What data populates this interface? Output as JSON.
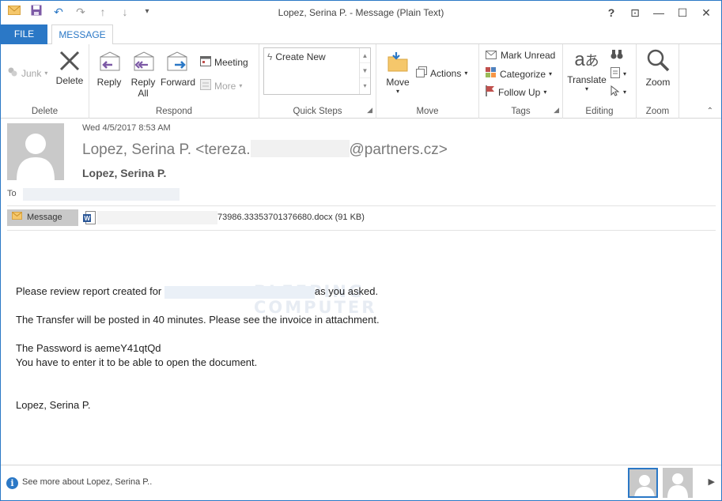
{
  "window": {
    "title": "Lopez, Serina P. - Message (Plain Text)"
  },
  "qat": {
    "undo": "↶",
    "redo": "↷",
    "up": "↑",
    "down": "↓",
    "customize": "▾"
  },
  "controls": {
    "help": "?",
    "restore_ribbon": "⊡",
    "minimize": "—",
    "maximize": "☐",
    "close": "✕"
  },
  "tabs": {
    "file": "FILE",
    "message": "MESSAGE"
  },
  "ribbon": {
    "delete_group": {
      "junk": "Junk",
      "delete": "Delete",
      "label": "Delete"
    },
    "respond_group": {
      "reply": "Reply",
      "reply_all_1": "Reply",
      "reply_all_2": "All",
      "forward": "Forward",
      "meeting": "Meeting",
      "more": "More",
      "label": "Respond"
    },
    "quicksteps_group": {
      "create_new": "Create New",
      "label": "Quick Steps"
    },
    "move_group": {
      "move": "Move",
      "actions": "Actions",
      "label": "Move"
    },
    "tags_group": {
      "mark_unread": "Mark Unread",
      "categorize": "Categorize",
      "follow_up": "Follow Up",
      "label": "Tags"
    },
    "editing_group": {
      "translate": "Translate",
      "label": "Editing"
    },
    "zoom_group": {
      "zoom": "Zoom",
      "label": "Zoom"
    }
  },
  "message": {
    "date": "Wed 4/5/2017 8:53 AM",
    "from_prefix": "Lopez, Serina P. <tereza.",
    "from_suffix": "@partners.cz>",
    "sender_name": "Lopez, Serina P.",
    "to_label": "To",
    "message_tab": "Message",
    "attachment": "73986.33353701376680.docx (91 KB)",
    "body": {
      "line1_a": "Please review report created for",
      "line1_b": "as you asked.",
      "line2": "The Transfer will be posted in 40 minutes. Please see the invoice in attachment.",
      "line3": "The Password is aemeY41qtQd",
      "line4": "You have to enter it to be able to open the document.",
      "signature": "Lopez, Serina P."
    },
    "watermark_1": "BLEEPING",
    "watermark_2": "COMPUTER"
  },
  "footer": {
    "see_more": "See more about Lopez, Serina P.."
  },
  "colors": {
    "accent": "#2b78c6",
    "avatar_bg": "#c9c9c9"
  }
}
